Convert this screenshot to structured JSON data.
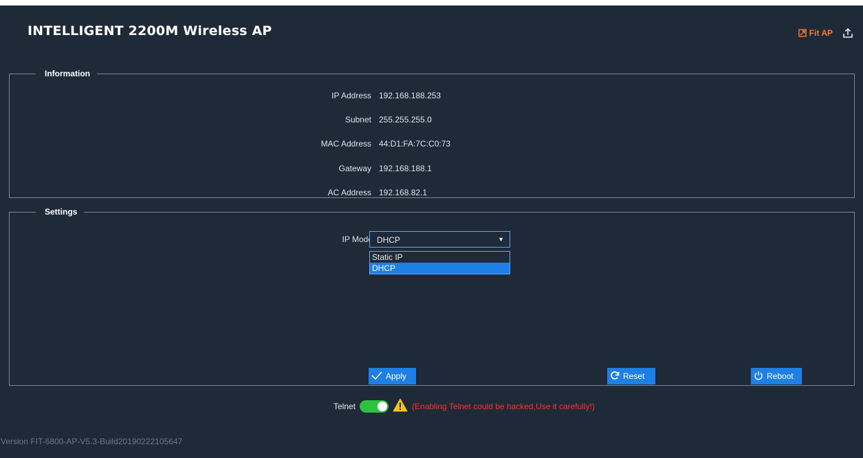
{
  "app": {
    "title": "INTELLIGENT 2200M Wireless AP"
  },
  "top_actions": {
    "fit_ap_label": "Fit AP"
  },
  "information": {
    "legend": "Information",
    "rows": [
      {
        "label": "IP Address",
        "value": "192.168.188.253"
      },
      {
        "label": "Subnet",
        "value": "255.255.255.0"
      },
      {
        "label": "MAC Address",
        "value": "44:D1:FA:7C:C0:73"
      },
      {
        "label": "Gateway",
        "value": "192.168.188.1"
      },
      {
        "label": "AC Address",
        "value": "192.168.82.1"
      }
    ]
  },
  "settings": {
    "legend": "Settings",
    "ip_mode": {
      "label": "IP Mode",
      "selected": "DHCP",
      "options": [
        "Static IP",
        "DHCP"
      ]
    },
    "buttons": {
      "apply": "Apply",
      "reset": "Reset",
      "reboot": "Reboot"
    }
  },
  "telnet": {
    "label": "Telnet",
    "enabled": true,
    "warning": "(Enabling Telnet could be hacked,Use it carefully!)"
  },
  "version": "Version FIT-6800-AP-V5.3-Build20190222105647",
  "colors": {
    "background": "#1e2a38",
    "accent": "#1e7fe6",
    "fit_ap": "#ff7a33",
    "warning": "#ff3030",
    "toggle_on": "#2ec23e"
  },
  "icons": [
    "fit-ap-icon",
    "export-icon",
    "check-icon",
    "refresh-icon",
    "power-icon",
    "warning-icon"
  ]
}
